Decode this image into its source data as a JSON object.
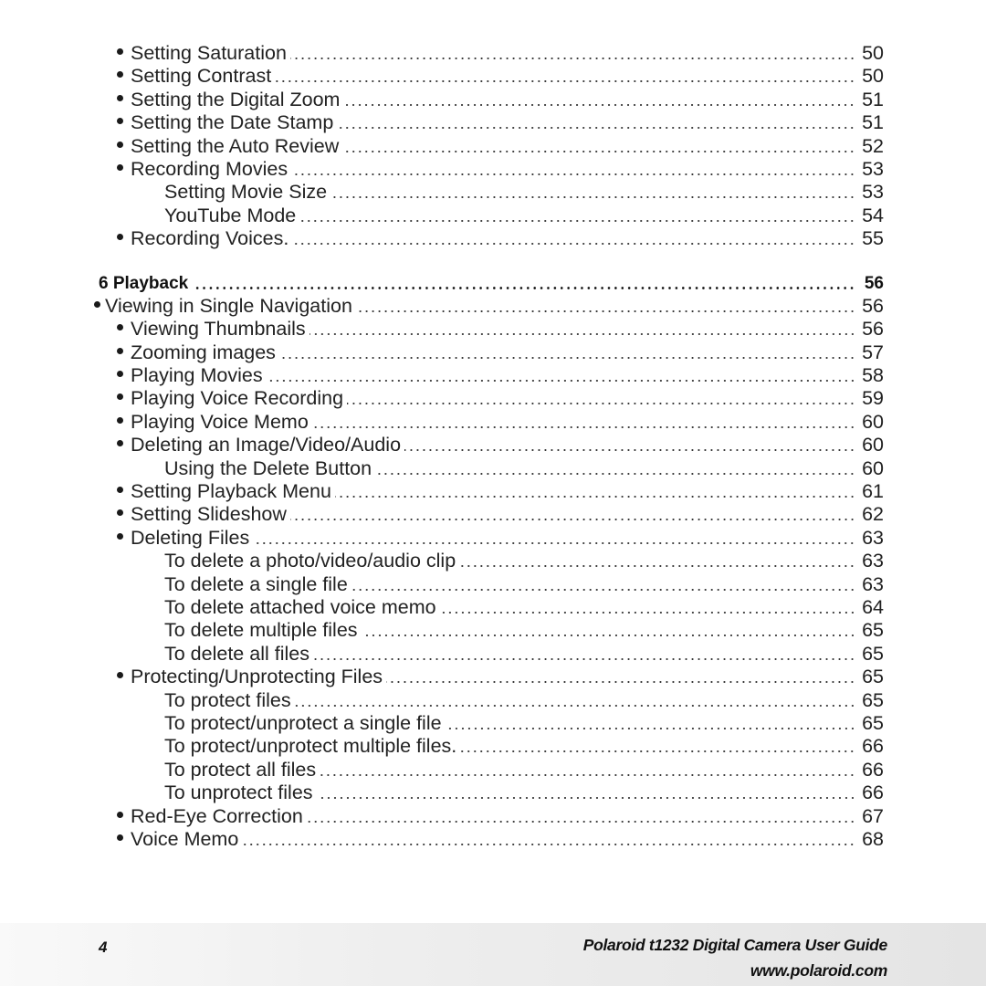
{
  "toc": [
    {
      "level": "b1",
      "label": "Setting Saturation",
      "page": "50"
    },
    {
      "level": "b1",
      "label": "Setting Contrast",
      "page": "50"
    },
    {
      "level": "b1",
      "label": "Setting the Digital Zoom",
      "page": "51"
    },
    {
      "level": "b1",
      "label": "Setting the Date Stamp",
      "page": "51"
    },
    {
      "level": "b1",
      "label": "Setting the Auto Review",
      "page": "52"
    },
    {
      "level": "b1",
      "label": "Recording Movies",
      "page": "53"
    },
    {
      "level": "sub",
      "label": "Setting Movie Size",
      "page": "53"
    },
    {
      "level": "sub",
      "label": "YouTube Mode",
      "page": "54"
    },
    {
      "level": "b1",
      "label": "Recording Voices.",
      "page": "55"
    },
    {
      "level": "spacer"
    },
    {
      "level": "chapter",
      "label": "6 Playback",
      "page": "56"
    },
    {
      "level": "top",
      "label": "Viewing in Single Navigation",
      "page": "56"
    },
    {
      "level": "b1",
      "label": "Viewing Thumbnails",
      "page": "56"
    },
    {
      "level": "b1",
      "label": "Zooming images",
      "page": "57"
    },
    {
      "level": "b1",
      "label": "Playing Movies",
      "page": "58"
    },
    {
      "level": "b1",
      "label": "Playing Voice Recording",
      "page": "59"
    },
    {
      "level": "b1",
      "label": "Playing Voice Memo",
      "page": "60"
    },
    {
      "level": "b1",
      "label": "Deleting an Image/Video/Audio",
      "page": "60"
    },
    {
      "level": "sub",
      "label": "Using the Delete Button",
      "page": "60"
    },
    {
      "level": "b1",
      "label": "Setting Playback Menu",
      "page": "61"
    },
    {
      "level": "b1",
      "label": "Setting Slideshow",
      "page": "62"
    },
    {
      "level": "b1",
      "label": "Deleting Files",
      "page": "63"
    },
    {
      "level": "sub",
      "label": "To delete a photo/video/audio clip",
      "page": "63"
    },
    {
      "level": "sub",
      "label": "To delete a single file",
      "page": "63"
    },
    {
      "level": "sub",
      "label": "To delete attached voice memo",
      "page": "64"
    },
    {
      "level": "sub",
      "label": "To delete multiple files",
      "page": "65"
    },
    {
      "level": "sub",
      "label": "To delete all files",
      "page": "65"
    },
    {
      "level": "b1",
      "label": "Protecting/Unprotecting Files",
      "page": "65"
    },
    {
      "level": "sub",
      "label": "To protect files",
      "page": "65"
    },
    {
      "level": "sub",
      "label": "To protect/unprotect a single file",
      "page": "65"
    },
    {
      "level": "sub",
      "label": "To protect/unprotect multiple files.",
      "page": "66"
    },
    {
      "level": "sub",
      "label": "To protect all files",
      "page": "66"
    },
    {
      "level": "sub",
      "label": "To unprotect files",
      "page": "66"
    },
    {
      "level": "b1",
      "label": "Red-Eye Correction",
      "page": "67"
    },
    {
      "level": "b1",
      "label": "Voice Memo",
      "page": "68"
    }
  ],
  "footer": {
    "page_number": "4",
    "title": "Polaroid t1232 Digital Camera User Guide",
    "url": "www.polaroid.com"
  }
}
